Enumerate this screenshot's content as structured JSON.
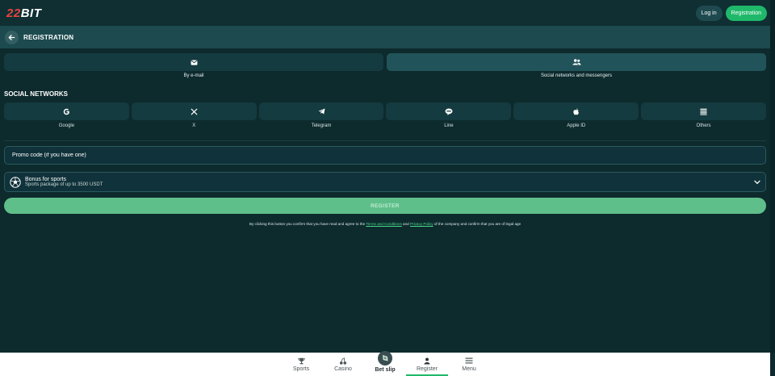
{
  "header": {
    "logo_red": "22",
    "logo_white": "BIT",
    "login_label": "Log in",
    "register_label": "Registration"
  },
  "regbar": {
    "title": "REGISTRATION"
  },
  "methods": [
    {
      "label": "By e-mail",
      "icon": "envelope-icon",
      "active": false
    },
    {
      "label": "Social networks and messengers",
      "icon": "users-icon",
      "active": true
    }
  ],
  "social": {
    "title": "SOCIAL NETWORKS",
    "items": [
      {
        "label": "Google",
        "icon": "google-icon"
      },
      {
        "label": "X",
        "icon": "x-icon"
      },
      {
        "label": "Telegram",
        "icon": "telegram-icon"
      },
      {
        "label": "Line",
        "icon": "line-icon"
      },
      {
        "label": "Apple ID",
        "icon": "apple-icon"
      },
      {
        "label": "Others",
        "icon": "list-icon"
      }
    ]
  },
  "promo": {
    "placeholder": "Promo code (if you have one)"
  },
  "bonus": {
    "title": "Bonus for sports",
    "subtitle": "Sports package of up to 3500 USDT"
  },
  "register_button": "REGISTER",
  "consent": {
    "before": "By clicking this button you confirm that you have read and agree to the ",
    "terms": "Terms and Conditions",
    "middle": " and ",
    "privacy": "Privacy Policy",
    "after": " of the company and confirm that you are of legal age"
  },
  "bottom_nav": [
    {
      "label": "Sports",
      "icon": "trophy-icon"
    },
    {
      "label": "Casino",
      "icon": "cherries-icon"
    },
    {
      "label": "Bet slip",
      "icon": "ticket-icon"
    },
    {
      "label": "Register",
      "icon": "user-icon"
    },
    {
      "label": "Menu",
      "icon": "hamburger-icon"
    }
  ],
  "colors": {
    "background": "#0d2a2d",
    "accent_green": "#1fb86a",
    "logo_red": "#e8453c"
  }
}
